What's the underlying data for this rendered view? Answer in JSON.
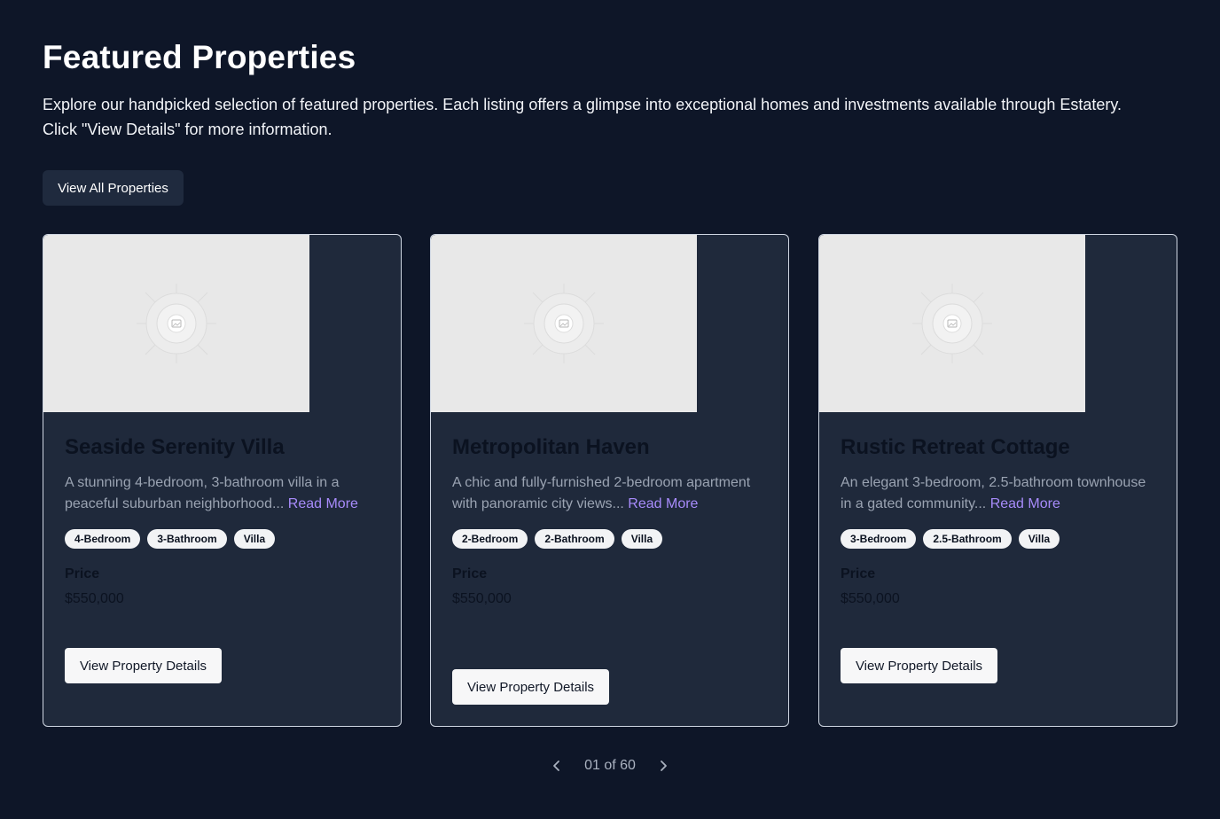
{
  "header": {
    "title": "Featured Properties",
    "intro": "Explore our handpicked selection of featured properties. Each listing offers a glimpse into exceptional homes and investments available through Estatery. Click \"View Details\" for more information.",
    "view_all_label": "View All Properties"
  },
  "cards": [
    {
      "title": "Seaside Serenity Villa",
      "description": "A stunning 4-bedroom, 3-bathroom villa in a peaceful suburban neighborhood...",
      "read_more": "Read More",
      "tags": [
        "4-Bedroom",
        "3-Bathroom",
        "Villa"
      ],
      "price_label": "Price",
      "price": "$550,000",
      "button_label": "View Property Details"
    },
    {
      "title": "Metropolitan Haven",
      "description": "A chic and fully-furnished 2-bedroom apartment with panoramic city views...",
      "read_more": "Read More",
      "tags": [
        "2-Bedroom",
        "2-Bathroom",
        "Villa"
      ],
      "price_label": "Price",
      "price": "$550,000",
      "button_label": "View Property Details"
    },
    {
      "title": "Rustic Retreat Cottage",
      "description": "An elegant 3-bedroom, 2.5-bathroom townhouse in a gated community...",
      "read_more": "Read More",
      "tags": [
        "3-Bedroom",
        "2.5-Bathroom",
        "Villa"
      ],
      "price_label": "Price",
      "price": "$550,000",
      "button_label": "View Property Details"
    }
  ],
  "pagination": {
    "text": "01 of 60",
    "prev_icon": "chevron-left-icon",
    "next_icon": "chevron-right-icon"
  },
  "colors": {
    "background": "#0e1628",
    "card_background": "#1f293b",
    "accent": "#a78bfa"
  }
}
